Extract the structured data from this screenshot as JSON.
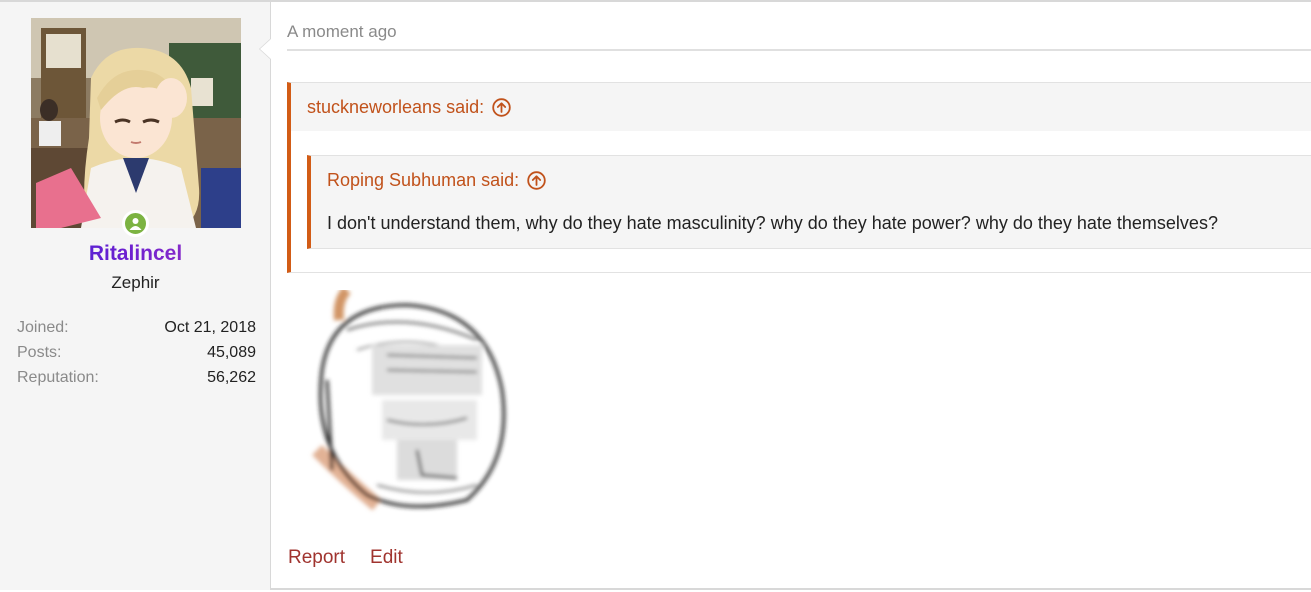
{
  "user": {
    "name": "Ritalincel",
    "title": "Zephir",
    "stats": [
      {
        "label": "Joined:",
        "value": "Oct 21, 2018"
      },
      {
        "label": "Posts:",
        "value": "45,089"
      },
      {
        "label": "Reputation:",
        "value": "56,262"
      }
    ],
    "online_color": "#7cb342"
  },
  "post": {
    "timestamp": "A moment ago",
    "quote": {
      "author": "stuckneworleans said:",
      "nested": {
        "author": "Roping Subhuman said:",
        "text": "I don't understand them, why do they hate masculinity? why do they hate power? why do they hate themselves?"
      }
    },
    "actions": {
      "report": "Report",
      "edit": "Edit"
    }
  },
  "colors": {
    "quote_accent": "#d25c16",
    "link": "#a0342f"
  }
}
